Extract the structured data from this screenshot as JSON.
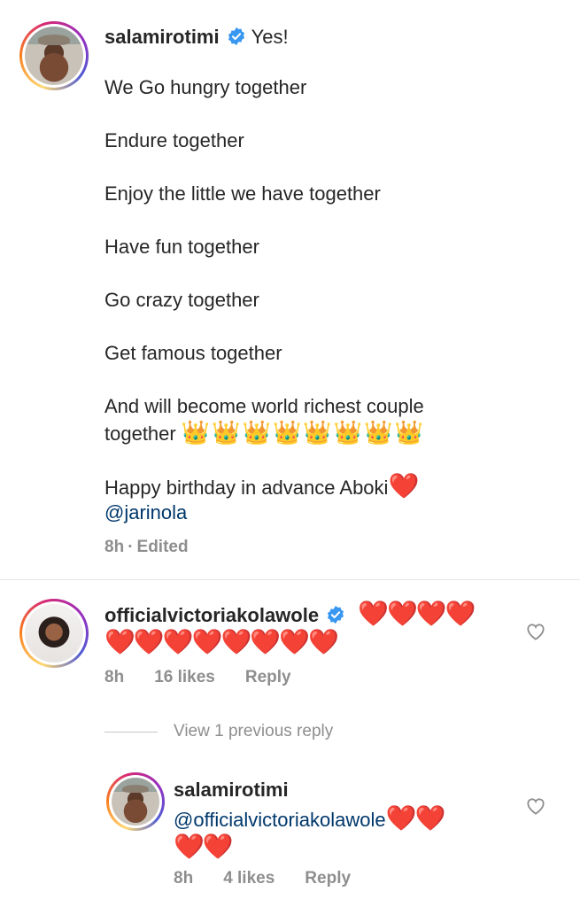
{
  "comment_main": {
    "username": "salamirotimi",
    "first_line": "Yes!",
    "lines": [
      "We Go hungry together",
      "Endure together",
      "Enjoy the little we have together",
      "Have fun together",
      "Go crazy together",
      "Get famous together"
    ],
    "couple_line_1": "And will become world richest couple",
    "couple_line_2": "together",
    "crowns": "👑👑👑👑👑👑👑👑",
    "birthday": "Happy birthday in advance Aboki",
    "birthday_heart": "❤️",
    "mention": "@jarinola",
    "time": "8h",
    "separator": "·",
    "edited": "Edited"
  },
  "comment_victoria": {
    "username": "officialvictoriakolawole",
    "hearts_1": "❤️❤️❤️❤️",
    "hearts_2": "❤️❤️❤️❤️❤️❤️❤️❤️",
    "time": "8h",
    "likes": "16 likes",
    "reply": "Reply"
  },
  "view_replies": "View 1 previous reply",
  "reply_comment": {
    "username": "salamirotimi",
    "mention": "@officialvictoriakolawole",
    "hearts_1": "❤️❤️",
    "hearts_2": "❤️❤️",
    "time": "8h",
    "likes": "4 likes",
    "reply": "Reply"
  },
  "colors": {
    "verified": "#3897f0",
    "mention": "#00376b",
    "meta": "#8e8e8e"
  }
}
